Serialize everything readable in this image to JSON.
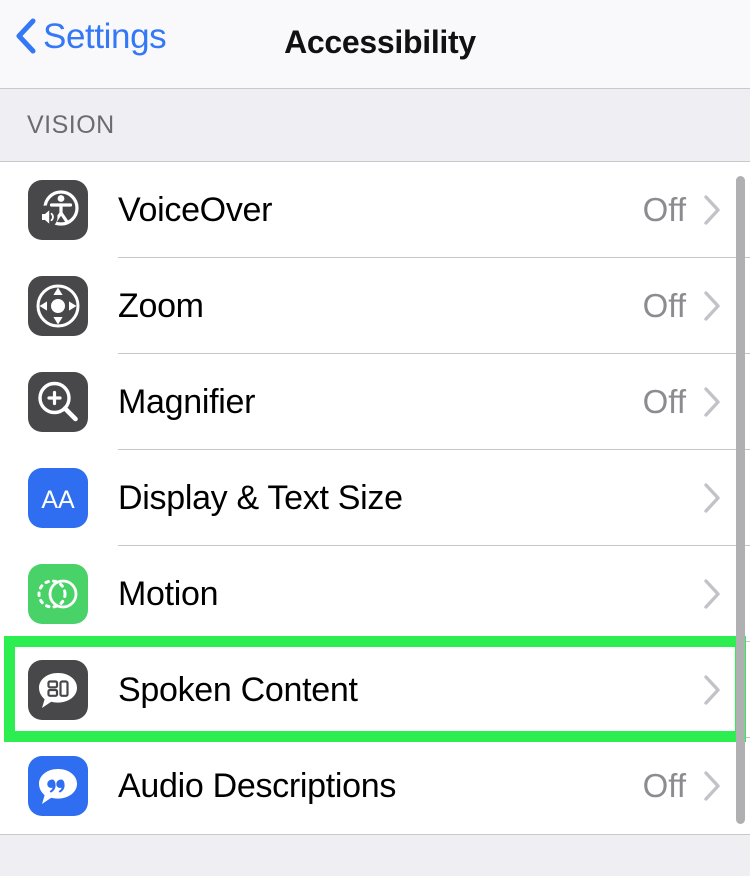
{
  "navbar": {
    "back_label": "Settings",
    "back_icon": "chevron-left-icon",
    "title": "Accessibility"
  },
  "section": {
    "header": "VISION"
  },
  "rows": [
    {
      "label": "VoiceOver",
      "value": "Off",
      "icon": "voiceover-icon",
      "icon_style": "dark",
      "chevron": "chevron-right-icon",
      "highlighted": false
    },
    {
      "label": "Zoom",
      "value": "Off",
      "icon": "zoom-icon",
      "icon_style": "dark",
      "chevron": "chevron-right-icon",
      "highlighted": false
    },
    {
      "label": "Magnifier",
      "value": "Off",
      "icon": "magnifier-icon",
      "icon_style": "dark",
      "chevron": "chevron-right-icon",
      "highlighted": false
    },
    {
      "label": "Display & Text Size",
      "value": "",
      "icon": "display-text-size-icon",
      "icon_style": "blue",
      "chevron": "chevron-right-icon",
      "highlighted": false
    },
    {
      "label": "Motion",
      "value": "",
      "icon": "motion-icon",
      "icon_style": "green",
      "chevron": "chevron-right-icon",
      "highlighted": false
    },
    {
      "label": "Spoken Content",
      "value": "",
      "icon": "spoken-content-icon",
      "icon_style": "dark",
      "chevron": "chevron-right-icon",
      "highlighted": true
    },
    {
      "label": "Audio Descriptions",
      "value": "Off",
      "icon": "audio-descriptions-icon",
      "icon_style": "blue",
      "chevron": "chevron-right-icon",
      "highlighted": false
    }
  ],
  "colors": {
    "accent_blue": "#3478f6",
    "highlight_green": "#2dee50",
    "icon_dark": "#48484a",
    "icon_blue": "#2f6ef0",
    "icon_green": "#49d268",
    "value_gray": "#8b8b90",
    "background_gray": "#eeeef3"
  },
  "scrollbar": {
    "visible": true
  }
}
